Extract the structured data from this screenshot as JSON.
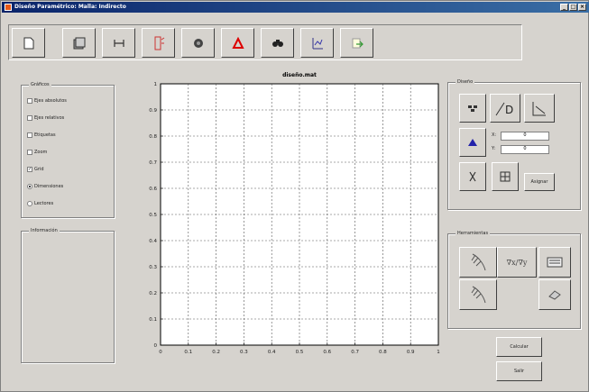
{
  "window": {
    "title": "Diseño Paramétrico: Malla: Indirecto"
  },
  "toolbar": {
    "icons": [
      "new-file-icon",
      "open-icon",
      "measure-icon",
      "flip-icon",
      "record-icon",
      "pdf-icon",
      "binoculars-icon",
      "chart-icon",
      "export-icon"
    ]
  },
  "graficos": {
    "title": "Gráficos",
    "items": [
      {
        "label": "Ejes absolutos",
        "type": "checkbox",
        "checked": false
      },
      {
        "label": "Ejes relativos",
        "type": "checkbox",
        "checked": false
      },
      {
        "label": "Etiquetas",
        "type": "checkbox",
        "checked": false
      },
      {
        "label": "Zoom",
        "type": "checkbox",
        "checked": false
      },
      {
        "label": "Grid",
        "type": "checkbox",
        "checked": true
      },
      {
        "label": "Dimensiones",
        "type": "radio",
        "checked": true
      },
      {
        "label": "Lectores",
        "type": "radio",
        "checked": false
      }
    ]
  },
  "informacion": {
    "title": "Información"
  },
  "plot": {
    "title": "diseño.mat"
  },
  "chart_data": {
    "type": "line",
    "title": "diseño.mat",
    "xlim": [
      0,
      1
    ],
    "ylim": [
      0,
      1
    ],
    "xticks": [
      "0",
      "0.1",
      "0.2",
      "0.3",
      "0.4",
      "0.5",
      "0.6",
      "0.7",
      "0.8",
      "0.9",
      "1"
    ],
    "yticks": [
      "0",
      "0.1",
      "0.2",
      "0.3",
      "0.4",
      "0.5",
      "0.6",
      "0.7",
      "0.8",
      "0.9",
      "1"
    ],
    "grid": true,
    "series": []
  },
  "diseno": {
    "title": "Diseño",
    "x_label": "X:",
    "y_label": "Y:",
    "x_value": "0",
    "y_value": "0",
    "asignar_label": "Asignar"
  },
  "herramientas": {
    "title": "Herramientas",
    "grad_label": "∇x/∇y"
  },
  "buttons": {
    "calcular": "Calcular",
    "salir": "Salir"
  }
}
